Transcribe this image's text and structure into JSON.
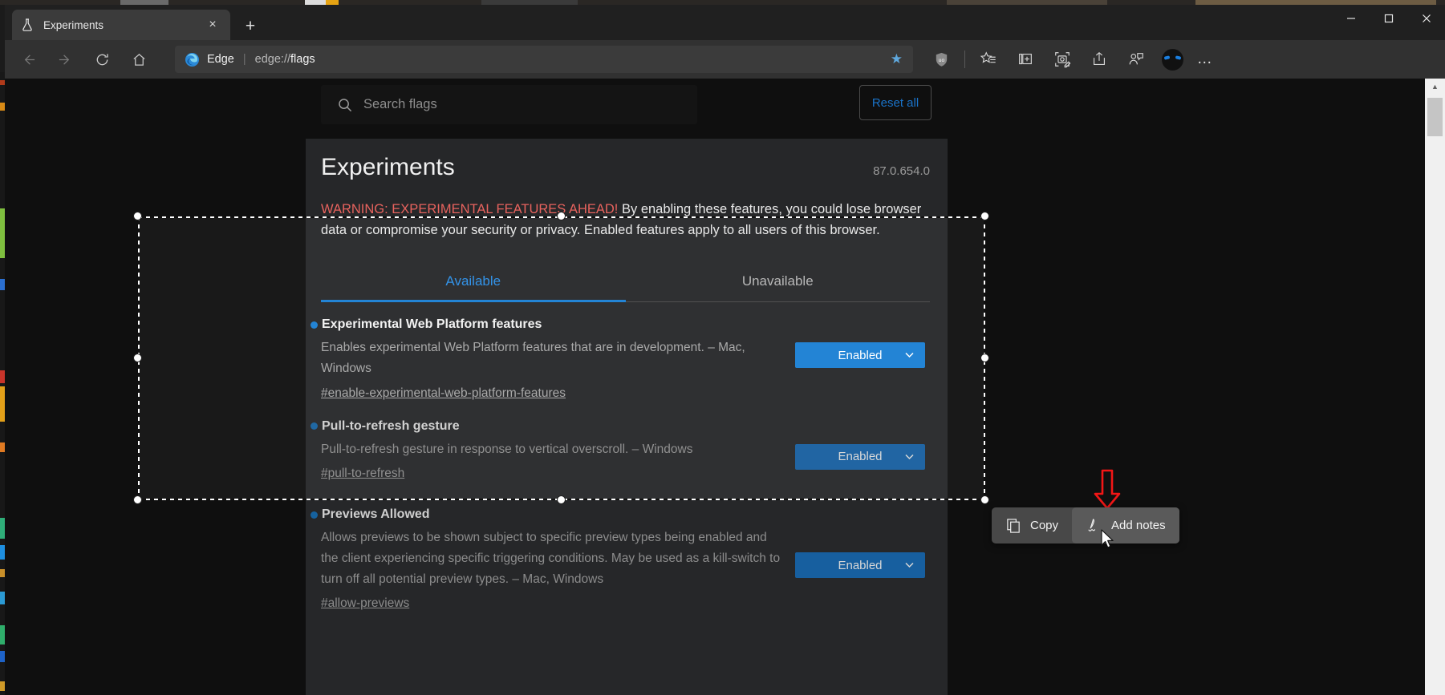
{
  "window": {
    "minimize_label": "Minimize",
    "maximize_label": "Maximize",
    "close_label": "Close"
  },
  "tabbar": {
    "tabs": [
      {
        "title": "Experiments",
        "favicon": "flask-icon",
        "close_label": "×"
      }
    ],
    "new_tab_label": "+"
  },
  "navbar": {
    "back_label": "Back",
    "forward_label": "Forward",
    "refresh_label": "Refresh",
    "home_label": "Home",
    "omnibox": {
      "brand": "Edge",
      "separator": "|",
      "url_scheme": "edge://",
      "url_path": "flags",
      "favorite_icon": "star-icon"
    },
    "icons": [
      "ublock-shield-icon",
      "favorites-icon",
      "collections-icon",
      "web-capture-icon",
      "share-icon",
      "share-with-device-icon"
    ],
    "profile_label": "Profile",
    "settings_more_label": "…"
  },
  "flags_page": {
    "search": {
      "placeholder": "Search flags",
      "value": "",
      "icon": "search-icon"
    },
    "reset_all_label": "Reset all",
    "title": "Experiments",
    "version": "87.0.654.0",
    "warning_bold": "WARNING: EXPERIMENTAL FEATURES AHEAD!",
    "warning_rest": " By enabling these features, you could lose browser data or compromise your security or privacy. Enabled features apply to all users of this browser.",
    "tabs": [
      {
        "label": "Available",
        "active": true
      },
      {
        "label": "Unavailable",
        "active": false
      }
    ],
    "flags": [
      {
        "name": "Experimental Web Platform features",
        "description": "Enables experimental Web Platform features that are in development. – Mac, Windows",
        "link": "#enable-experimental-web-platform-features",
        "state": "Enabled",
        "chevron": "⌄"
      },
      {
        "name": "Pull-to-refresh gesture",
        "description": "Pull-to-refresh gesture in response to vertical overscroll. – Windows",
        "link": "#pull-to-refresh",
        "state": "Enabled",
        "chevron": "⌄"
      },
      {
        "name": "Previews Allowed",
        "description": "Allows previews to be shown subject to specific preview types being enabled and the client experiencing specific triggering conditions. May be used as a kill-switch to turn off all potential preview types. – Mac, Windows",
        "link": "#allow-previews",
        "state": "Enabled",
        "chevron": "⌄"
      }
    ]
  },
  "context_menu": {
    "items": [
      {
        "label": "Copy",
        "icon": "copy-icon",
        "hovered": false
      },
      {
        "label": "Add notes",
        "icon": "pen-notes-icon",
        "hovered": true
      }
    ]
  },
  "annotation": {
    "arrow_color": "#f21616",
    "arrow_name": "red-down-arrow"
  },
  "colors": {
    "accent_blue": "#1a7fd4",
    "link_blue": "#2a8fe8",
    "warning_red": "#e8635e",
    "panel_bg": "#262729",
    "page_bg": "#0f0f0f"
  },
  "scrollbar": {
    "up_label": "▲",
    "down_label": "▼"
  }
}
